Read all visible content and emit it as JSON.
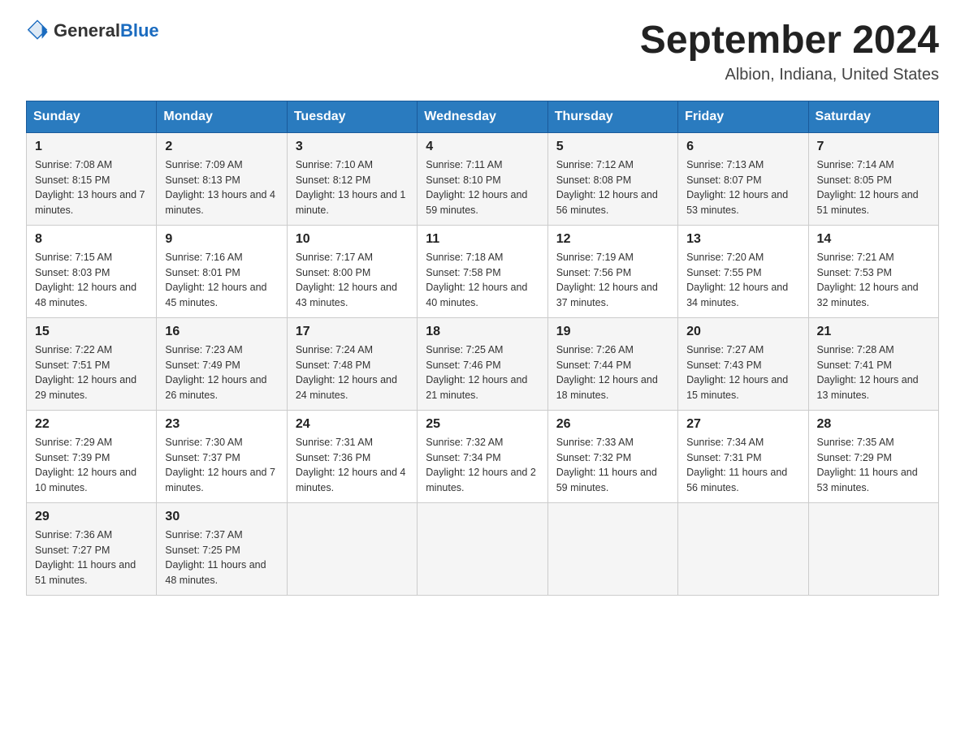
{
  "header": {
    "logo_general": "General",
    "logo_blue": "Blue",
    "title": "September 2024",
    "subtitle": "Albion, Indiana, United States"
  },
  "weekdays": [
    "Sunday",
    "Monday",
    "Tuesday",
    "Wednesday",
    "Thursday",
    "Friday",
    "Saturday"
  ],
  "weeks": [
    [
      {
        "day": "1",
        "sunrise": "7:08 AM",
        "sunset": "8:15 PM",
        "daylight": "13 hours and 7 minutes."
      },
      {
        "day": "2",
        "sunrise": "7:09 AM",
        "sunset": "8:13 PM",
        "daylight": "13 hours and 4 minutes."
      },
      {
        "day": "3",
        "sunrise": "7:10 AM",
        "sunset": "8:12 PM",
        "daylight": "13 hours and 1 minute."
      },
      {
        "day": "4",
        "sunrise": "7:11 AM",
        "sunset": "8:10 PM",
        "daylight": "12 hours and 59 minutes."
      },
      {
        "day": "5",
        "sunrise": "7:12 AM",
        "sunset": "8:08 PM",
        "daylight": "12 hours and 56 minutes."
      },
      {
        "day": "6",
        "sunrise": "7:13 AM",
        "sunset": "8:07 PM",
        "daylight": "12 hours and 53 minutes."
      },
      {
        "day": "7",
        "sunrise": "7:14 AM",
        "sunset": "8:05 PM",
        "daylight": "12 hours and 51 minutes."
      }
    ],
    [
      {
        "day": "8",
        "sunrise": "7:15 AM",
        "sunset": "8:03 PM",
        "daylight": "12 hours and 48 minutes."
      },
      {
        "day": "9",
        "sunrise": "7:16 AM",
        "sunset": "8:01 PM",
        "daylight": "12 hours and 45 minutes."
      },
      {
        "day": "10",
        "sunrise": "7:17 AM",
        "sunset": "8:00 PM",
        "daylight": "12 hours and 43 minutes."
      },
      {
        "day": "11",
        "sunrise": "7:18 AM",
        "sunset": "7:58 PM",
        "daylight": "12 hours and 40 minutes."
      },
      {
        "day": "12",
        "sunrise": "7:19 AM",
        "sunset": "7:56 PM",
        "daylight": "12 hours and 37 minutes."
      },
      {
        "day": "13",
        "sunrise": "7:20 AM",
        "sunset": "7:55 PM",
        "daylight": "12 hours and 34 minutes."
      },
      {
        "day": "14",
        "sunrise": "7:21 AM",
        "sunset": "7:53 PM",
        "daylight": "12 hours and 32 minutes."
      }
    ],
    [
      {
        "day": "15",
        "sunrise": "7:22 AM",
        "sunset": "7:51 PM",
        "daylight": "12 hours and 29 minutes."
      },
      {
        "day": "16",
        "sunrise": "7:23 AM",
        "sunset": "7:49 PM",
        "daylight": "12 hours and 26 minutes."
      },
      {
        "day": "17",
        "sunrise": "7:24 AM",
        "sunset": "7:48 PM",
        "daylight": "12 hours and 24 minutes."
      },
      {
        "day": "18",
        "sunrise": "7:25 AM",
        "sunset": "7:46 PM",
        "daylight": "12 hours and 21 minutes."
      },
      {
        "day": "19",
        "sunrise": "7:26 AM",
        "sunset": "7:44 PM",
        "daylight": "12 hours and 18 minutes."
      },
      {
        "day": "20",
        "sunrise": "7:27 AM",
        "sunset": "7:43 PM",
        "daylight": "12 hours and 15 minutes."
      },
      {
        "day": "21",
        "sunrise": "7:28 AM",
        "sunset": "7:41 PM",
        "daylight": "12 hours and 13 minutes."
      }
    ],
    [
      {
        "day": "22",
        "sunrise": "7:29 AM",
        "sunset": "7:39 PM",
        "daylight": "12 hours and 10 minutes."
      },
      {
        "day": "23",
        "sunrise": "7:30 AM",
        "sunset": "7:37 PM",
        "daylight": "12 hours and 7 minutes."
      },
      {
        "day": "24",
        "sunrise": "7:31 AM",
        "sunset": "7:36 PM",
        "daylight": "12 hours and 4 minutes."
      },
      {
        "day": "25",
        "sunrise": "7:32 AM",
        "sunset": "7:34 PM",
        "daylight": "12 hours and 2 minutes."
      },
      {
        "day": "26",
        "sunrise": "7:33 AM",
        "sunset": "7:32 PM",
        "daylight": "11 hours and 59 minutes."
      },
      {
        "day": "27",
        "sunrise": "7:34 AM",
        "sunset": "7:31 PM",
        "daylight": "11 hours and 56 minutes."
      },
      {
        "day": "28",
        "sunrise": "7:35 AM",
        "sunset": "7:29 PM",
        "daylight": "11 hours and 53 minutes."
      }
    ],
    [
      {
        "day": "29",
        "sunrise": "7:36 AM",
        "sunset": "7:27 PM",
        "daylight": "11 hours and 51 minutes."
      },
      {
        "day": "30",
        "sunrise": "7:37 AM",
        "sunset": "7:25 PM",
        "daylight": "11 hours and 48 minutes."
      },
      null,
      null,
      null,
      null,
      null
    ]
  ],
  "labels": {
    "sunrise": "Sunrise:",
    "sunset": "Sunset:",
    "daylight": "Daylight:"
  }
}
